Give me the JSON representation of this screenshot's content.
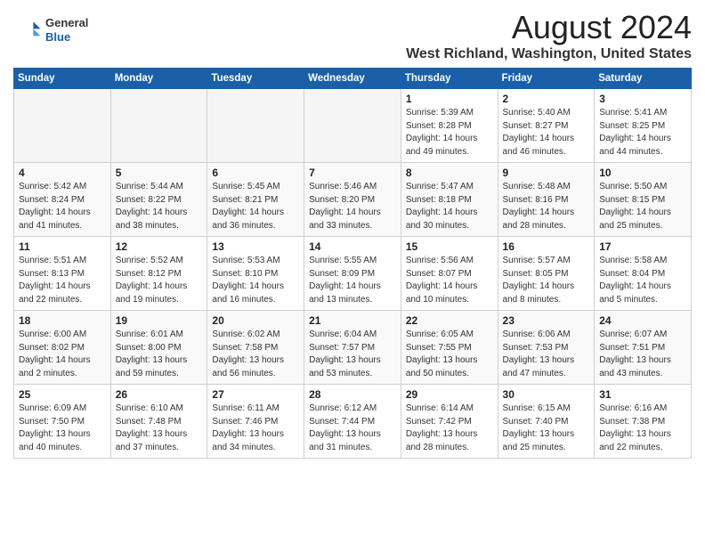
{
  "header": {
    "logo_line1": "General",
    "logo_line2": "Blue",
    "month_title": "August 2024",
    "location": "West Richland, Washington, United States"
  },
  "weekdays": [
    "Sunday",
    "Monday",
    "Tuesday",
    "Wednesday",
    "Thursday",
    "Friday",
    "Saturday"
  ],
  "weeks": [
    [
      {
        "day": "",
        "info": ""
      },
      {
        "day": "",
        "info": ""
      },
      {
        "day": "",
        "info": ""
      },
      {
        "day": "",
        "info": ""
      },
      {
        "day": "1",
        "info": "Sunrise: 5:39 AM\nSunset: 8:28 PM\nDaylight: 14 hours\nand 49 minutes."
      },
      {
        "day": "2",
        "info": "Sunrise: 5:40 AM\nSunset: 8:27 PM\nDaylight: 14 hours\nand 46 minutes."
      },
      {
        "day": "3",
        "info": "Sunrise: 5:41 AM\nSunset: 8:25 PM\nDaylight: 14 hours\nand 44 minutes."
      }
    ],
    [
      {
        "day": "4",
        "info": "Sunrise: 5:42 AM\nSunset: 8:24 PM\nDaylight: 14 hours\nand 41 minutes."
      },
      {
        "day": "5",
        "info": "Sunrise: 5:44 AM\nSunset: 8:22 PM\nDaylight: 14 hours\nand 38 minutes."
      },
      {
        "day": "6",
        "info": "Sunrise: 5:45 AM\nSunset: 8:21 PM\nDaylight: 14 hours\nand 36 minutes."
      },
      {
        "day": "7",
        "info": "Sunrise: 5:46 AM\nSunset: 8:20 PM\nDaylight: 14 hours\nand 33 minutes."
      },
      {
        "day": "8",
        "info": "Sunrise: 5:47 AM\nSunset: 8:18 PM\nDaylight: 14 hours\nand 30 minutes."
      },
      {
        "day": "9",
        "info": "Sunrise: 5:48 AM\nSunset: 8:16 PM\nDaylight: 14 hours\nand 28 minutes."
      },
      {
        "day": "10",
        "info": "Sunrise: 5:50 AM\nSunset: 8:15 PM\nDaylight: 14 hours\nand 25 minutes."
      }
    ],
    [
      {
        "day": "11",
        "info": "Sunrise: 5:51 AM\nSunset: 8:13 PM\nDaylight: 14 hours\nand 22 minutes."
      },
      {
        "day": "12",
        "info": "Sunrise: 5:52 AM\nSunset: 8:12 PM\nDaylight: 14 hours\nand 19 minutes."
      },
      {
        "day": "13",
        "info": "Sunrise: 5:53 AM\nSunset: 8:10 PM\nDaylight: 14 hours\nand 16 minutes."
      },
      {
        "day": "14",
        "info": "Sunrise: 5:55 AM\nSunset: 8:09 PM\nDaylight: 14 hours\nand 13 minutes."
      },
      {
        "day": "15",
        "info": "Sunrise: 5:56 AM\nSunset: 8:07 PM\nDaylight: 14 hours\nand 10 minutes."
      },
      {
        "day": "16",
        "info": "Sunrise: 5:57 AM\nSunset: 8:05 PM\nDaylight: 14 hours\nand 8 minutes."
      },
      {
        "day": "17",
        "info": "Sunrise: 5:58 AM\nSunset: 8:04 PM\nDaylight: 14 hours\nand 5 minutes."
      }
    ],
    [
      {
        "day": "18",
        "info": "Sunrise: 6:00 AM\nSunset: 8:02 PM\nDaylight: 14 hours\nand 2 minutes."
      },
      {
        "day": "19",
        "info": "Sunrise: 6:01 AM\nSunset: 8:00 PM\nDaylight: 13 hours\nand 59 minutes."
      },
      {
        "day": "20",
        "info": "Sunrise: 6:02 AM\nSunset: 7:58 PM\nDaylight: 13 hours\nand 56 minutes."
      },
      {
        "day": "21",
        "info": "Sunrise: 6:04 AM\nSunset: 7:57 PM\nDaylight: 13 hours\nand 53 minutes."
      },
      {
        "day": "22",
        "info": "Sunrise: 6:05 AM\nSunset: 7:55 PM\nDaylight: 13 hours\nand 50 minutes."
      },
      {
        "day": "23",
        "info": "Sunrise: 6:06 AM\nSunset: 7:53 PM\nDaylight: 13 hours\nand 47 minutes."
      },
      {
        "day": "24",
        "info": "Sunrise: 6:07 AM\nSunset: 7:51 PM\nDaylight: 13 hours\nand 43 minutes."
      }
    ],
    [
      {
        "day": "25",
        "info": "Sunrise: 6:09 AM\nSunset: 7:50 PM\nDaylight: 13 hours\nand 40 minutes."
      },
      {
        "day": "26",
        "info": "Sunrise: 6:10 AM\nSunset: 7:48 PM\nDaylight: 13 hours\nand 37 minutes."
      },
      {
        "day": "27",
        "info": "Sunrise: 6:11 AM\nSunset: 7:46 PM\nDaylight: 13 hours\nand 34 minutes."
      },
      {
        "day": "28",
        "info": "Sunrise: 6:12 AM\nSunset: 7:44 PM\nDaylight: 13 hours\nand 31 minutes."
      },
      {
        "day": "29",
        "info": "Sunrise: 6:14 AM\nSunset: 7:42 PM\nDaylight: 13 hours\nand 28 minutes."
      },
      {
        "day": "30",
        "info": "Sunrise: 6:15 AM\nSunset: 7:40 PM\nDaylight: 13 hours\nand 25 minutes."
      },
      {
        "day": "31",
        "info": "Sunrise: 6:16 AM\nSunset: 7:38 PM\nDaylight: 13 hours\nand 22 minutes."
      }
    ]
  ]
}
